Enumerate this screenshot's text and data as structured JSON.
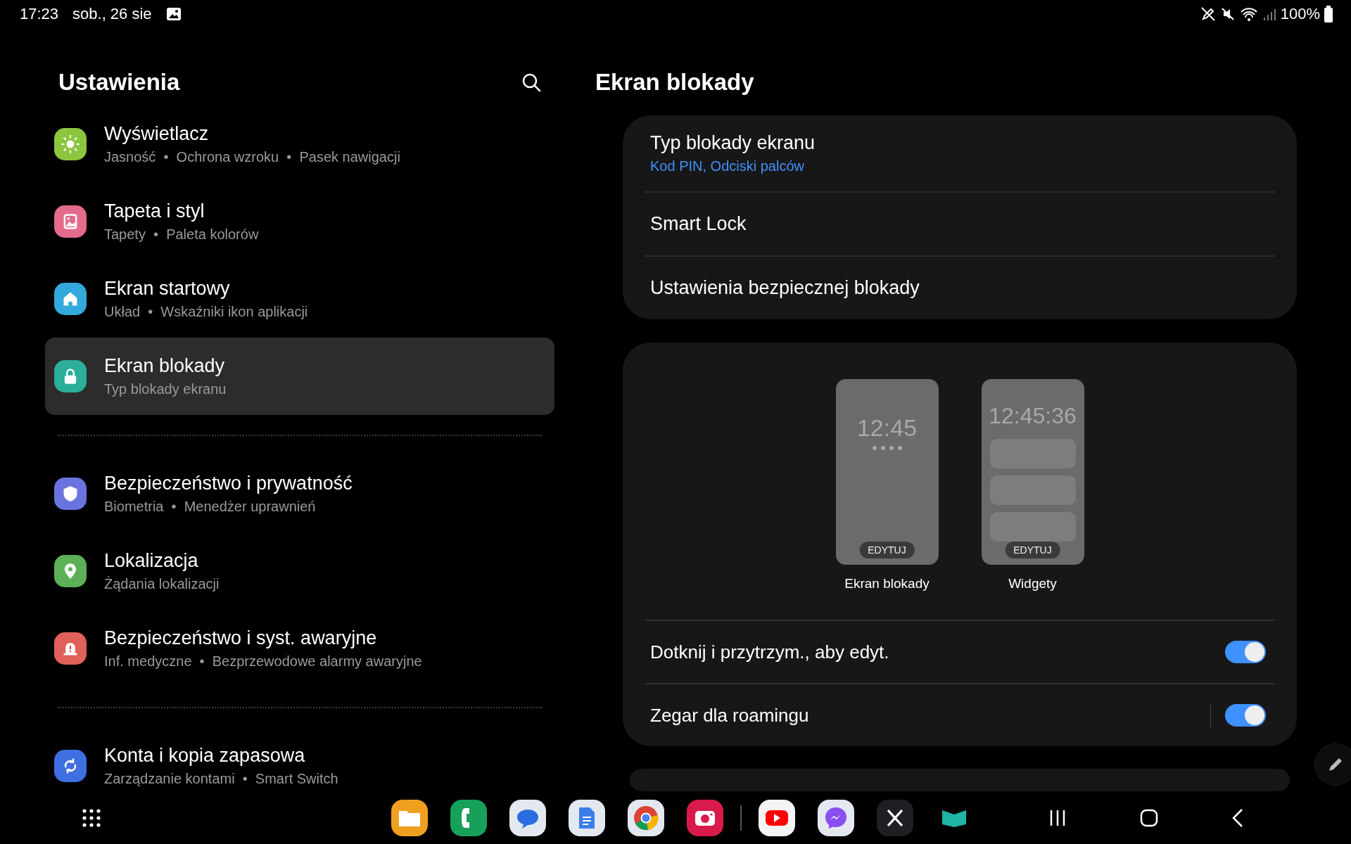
{
  "status_bar": {
    "time": "17:23",
    "date": "sob., 26 sie",
    "battery": "100%"
  },
  "settings": {
    "title": "Ustawienia",
    "groups": [
      {
        "items": [
          {
            "title": "Wyświetlacz",
            "subtitle": "Jasność  •  Ochrona wzroku  •  Pasek nawigacji",
            "kind": "sun",
            "color": "#8cc63f",
            "selected": false
          },
          {
            "title": "Tapeta i styl",
            "subtitle": "Tapety  •  Paleta kolorów",
            "kind": "picture",
            "color": "#e56b8c",
            "selected": false
          },
          {
            "title": "Ekran startowy",
            "subtitle": "Układ  •  Wskaźniki ikon aplikacji",
            "kind": "home",
            "color": "#33a9dc",
            "selected": false
          },
          {
            "title": "Ekran blokady",
            "subtitle": "Typ blokady ekranu",
            "kind": "lock",
            "color": "#2bae9a",
            "selected": true
          }
        ]
      },
      {
        "items": [
          {
            "title": "Bezpieczeństwo i prywatność",
            "subtitle": "Biometria  •  Menedżer uprawnień",
            "kind": "shield",
            "color": "#6a74e0",
            "selected": false
          },
          {
            "title": "Lokalizacja",
            "subtitle": "Żądania lokalizacji",
            "kind": "pin",
            "color": "#5db055",
            "selected": false
          },
          {
            "title": "Bezpieczeństwo i syst. awaryjne",
            "subtitle": "Inf. medyczne  •  Bezprzewodowe alarmy awaryjne",
            "kind": "alert",
            "color": "#e0605a",
            "selected": false
          }
        ]
      },
      {
        "items": [
          {
            "title": "Konta i kopia zapasowa",
            "subtitle": "Zarządzanie kontami  •  Smart Switch",
            "kind": "sync",
            "color": "#3f6fe0",
            "selected": false
          }
        ]
      }
    ]
  },
  "detail": {
    "title": "Ekran blokady",
    "rows": [
      {
        "title": "Typ blokady ekranu",
        "value": "Kod PIN, Odciski palców"
      },
      {
        "title": "Smart Lock"
      },
      {
        "title": "Ustawienia bezpiecznej blokady"
      }
    ],
    "previews": [
      {
        "kind": "lockscreen",
        "clock": "12:45",
        "button": "EDYTUJ",
        "label": "Ekran blokady"
      },
      {
        "kind": "widgets",
        "clock": "12:45:36",
        "button": "EDYTUJ",
        "label": "Widgety"
      }
    ],
    "toggles": [
      {
        "label": "Dotknij i przytrzym., aby edyt.",
        "on": true,
        "separator": false
      },
      {
        "label": "Zegar dla roamingu",
        "on": true,
        "separator": true
      }
    ]
  }
}
